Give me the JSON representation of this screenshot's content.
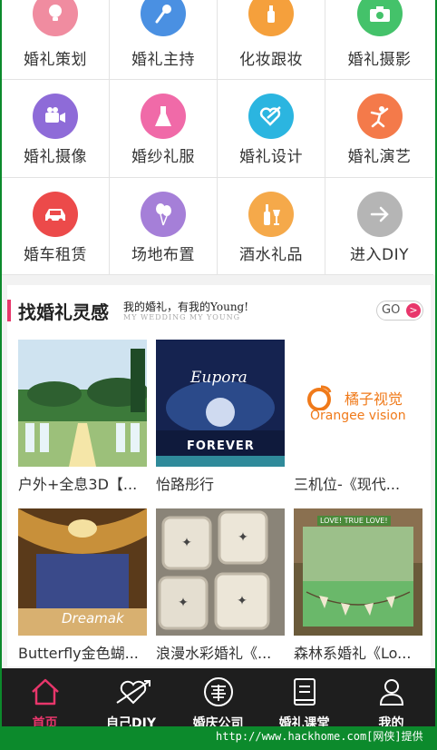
{
  "categories": [
    {
      "label": "婚礼策划",
      "icon": "lightbulb-icon",
      "color": "#f08ca0"
    },
    {
      "label": "婚礼主持",
      "icon": "microphone-icon",
      "color": "#4a90e2"
    },
    {
      "label": "化妆跟妆",
      "icon": "makeup-bottle-icon",
      "color": "#f5a03c"
    },
    {
      "label": "婚礼摄影",
      "icon": "camera-icon",
      "color": "#44c26a"
    },
    {
      "label": "婚礼摄像",
      "icon": "video-camera-icon",
      "color": "#8e6bd8"
    },
    {
      "label": "婚纱礼服",
      "icon": "dress-icon",
      "color": "#f06aa8"
    },
    {
      "label": "婚礼设计",
      "icon": "heart-pen-icon",
      "color": "#2bb5e0"
    },
    {
      "label": "婚礼演艺",
      "icon": "dancer-icon",
      "color": "#f47a4a"
    },
    {
      "label": "婚车租赁",
      "icon": "car-icon",
      "color": "#ec4a4a"
    },
    {
      "label": "场地布置",
      "icon": "balloons-icon",
      "color": "#a57fd8"
    },
    {
      "label": "酒水礼品",
      "icon": "wine-icon",
      "color": "#f5a94a"
    },
    {
      "label": "进入DIY",
      "icon": "arrow-right-icon",
      "color": "#b5b5b5"
    }
  ],
  "inspiration": {
    "title": "找婚礼灵感",
    "slogan": "我的婚礼，有我的Young!",
    "slogan_sub": "MY WEDDING  MY YOUNG",
    "go_label": "GO",
    "go_arrow": ">",
    "items": [
      {
        "caption": "户外+全息3D【..."
      },
      {
        "caption": "怡路彤行",
        "image_text_1": "Eupora",
        "image_text_2": "FOREVER"
      },
      {
        "caption": "三机位-《现代...",
        "image_text_1": "橘子视觉",
        "image_text_2": "Orangee vision"
      },
      {
        "caption": "Butterfly金色蝴...",
        "image_text_1": "Dreamak"
      },
      {
        "caption": "浪漫水彩婚礼《..."
      },
      {
        "caption": "森林系婚礼《Lo...",
        "image_text_1": "LOVE! TRUE LOVE!"
      }
    ]
  },
  "nav": [
    {
      "label": "首页",
      "icon": "home-icon",
      "active": true
    },
    {
      "label": "自己DIY",
      "icon": "heart-arrow-icon"
    },
    {
      "label": "婚庆公司",
      "icon": "double-happiness-icon"
    },
    {
      "label": "婚礼课堂",
      "icon": "book-icon"
    },
    {
      "label": "我的",
      "icon": "user-icon"
    }
  ],
  "watermark": "http://www.hackhome.com[网侠]提供",
  "colors": {
    "accent": "#e8366b",
    "nav_bg": "#1e1e1e",
    "frame": "#0c8a2c"
  }
}
